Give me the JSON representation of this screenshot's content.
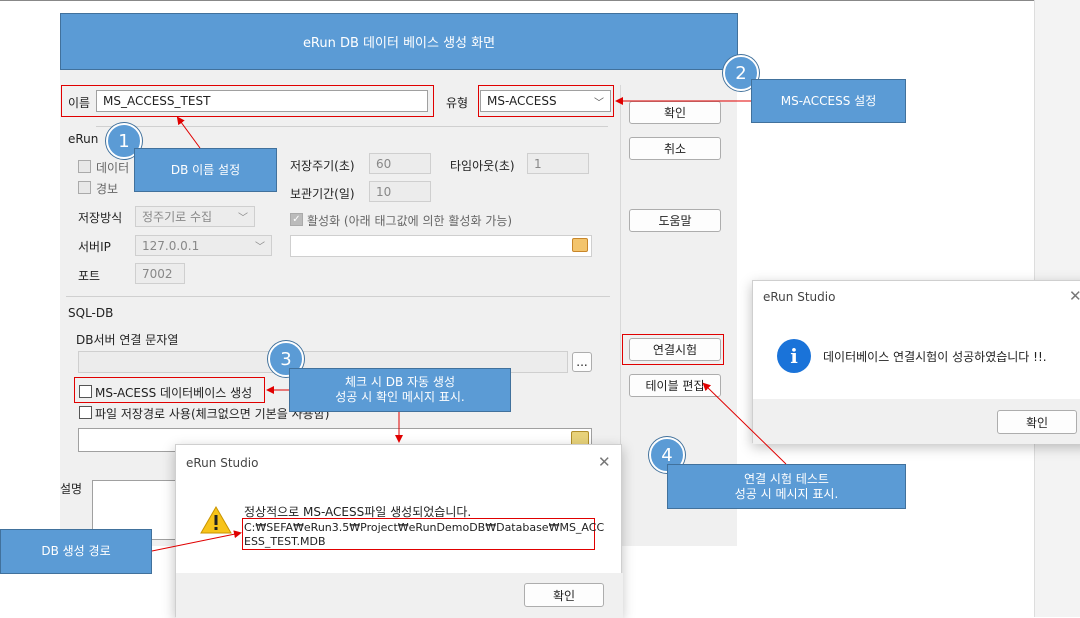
{
  "banner": {
    "title": "eRun DB 데이터 베이스 생성 화면"
  },
  "form": {
    "name_label": "이름",
    "name_value": "MS_ACCESS_TEST",
    "type_label": "유형",
    "type_value": "MS-ACCESS",
    "erun_group": "eRun",
    "chk_data_partial": "데이터",
    "chk_alarm_partial": "경보",
    "save_method_label": "저장방식",
    "save_method_value": "정주기로 수집",
    "server_ip_label": "서버IP",
    "server_ip_value": "127.0.0.1",
    "port_label": "포트",
    "port_value": "7002",
    "save_period_label": "저장주기(초)",
    "save_period_value": "60",
    "timeout_label": "타임아웃(초)",
    "timeout_value": "1",
    "retention_label": "보관기간(일)",
    "retention_value": "10",
    "activate_label": "활성화 (아래 태그값에 의한 활성화 가능)",
    "sqldb_group": "SQL-DB",
    "conn_string_label": "DB서버 연결 문자열",
    "browse_label": "...",
    "create_db_label": "MS-ACESS 데이터베이스 생성",
    "file_path_label": "파일 저장경로 사용(체크없으면 기본을 사용함)",
    "desc_label": "설명"
  },
  "buttons": {
    "ok": "확인",
    "cancel": "취소",
    "help": "도움말",
    "test_conn": "연결시험",
    "table_edit": "테이블 편집"
  },
  "callouts": {
    "c1_num": "1",
    "c1_text": "DB 이름 설정",
    "c2_num": "2",
    "c2_text": "MS-ACCESS 설정",
    "c3_num": "3",
    "c3_line1": "체크 시 DB 자동 생성",
    "c3_line2": "성공 시 확인 메시지 표시.",
    "c4_num": "4",
    "c4_line1": "연결 시험 테스트",
    "c4_line2": "성공 시 메시지 표시.",
    "path_text": "DB 생성 경로"
  },
  "dialog_conn": {
    "title": "eRun Studio",
    "close": "✕",
    "message": "데이터베이스 연결시험이 성공하였습니다 !!.",
    "ok": "확인"
  },
  "dialog_create": {
    "title": "eRun Studio",
    "close": "✕",
    "message": "정상적으로 MS-ACESS파일 생성되었습니다.",
    "path_line1": "C:₩SEFA₩eRun3.5₩Project₩eRunDemoDB₩Database₩MS_ACC",
    "path_line2": "ESS_TEST.MDB",
    "ok": "확인"
  },
  "colors": {
    "accent": "#5b9bd5",
    "highlight": "#e00000"
  }
}
